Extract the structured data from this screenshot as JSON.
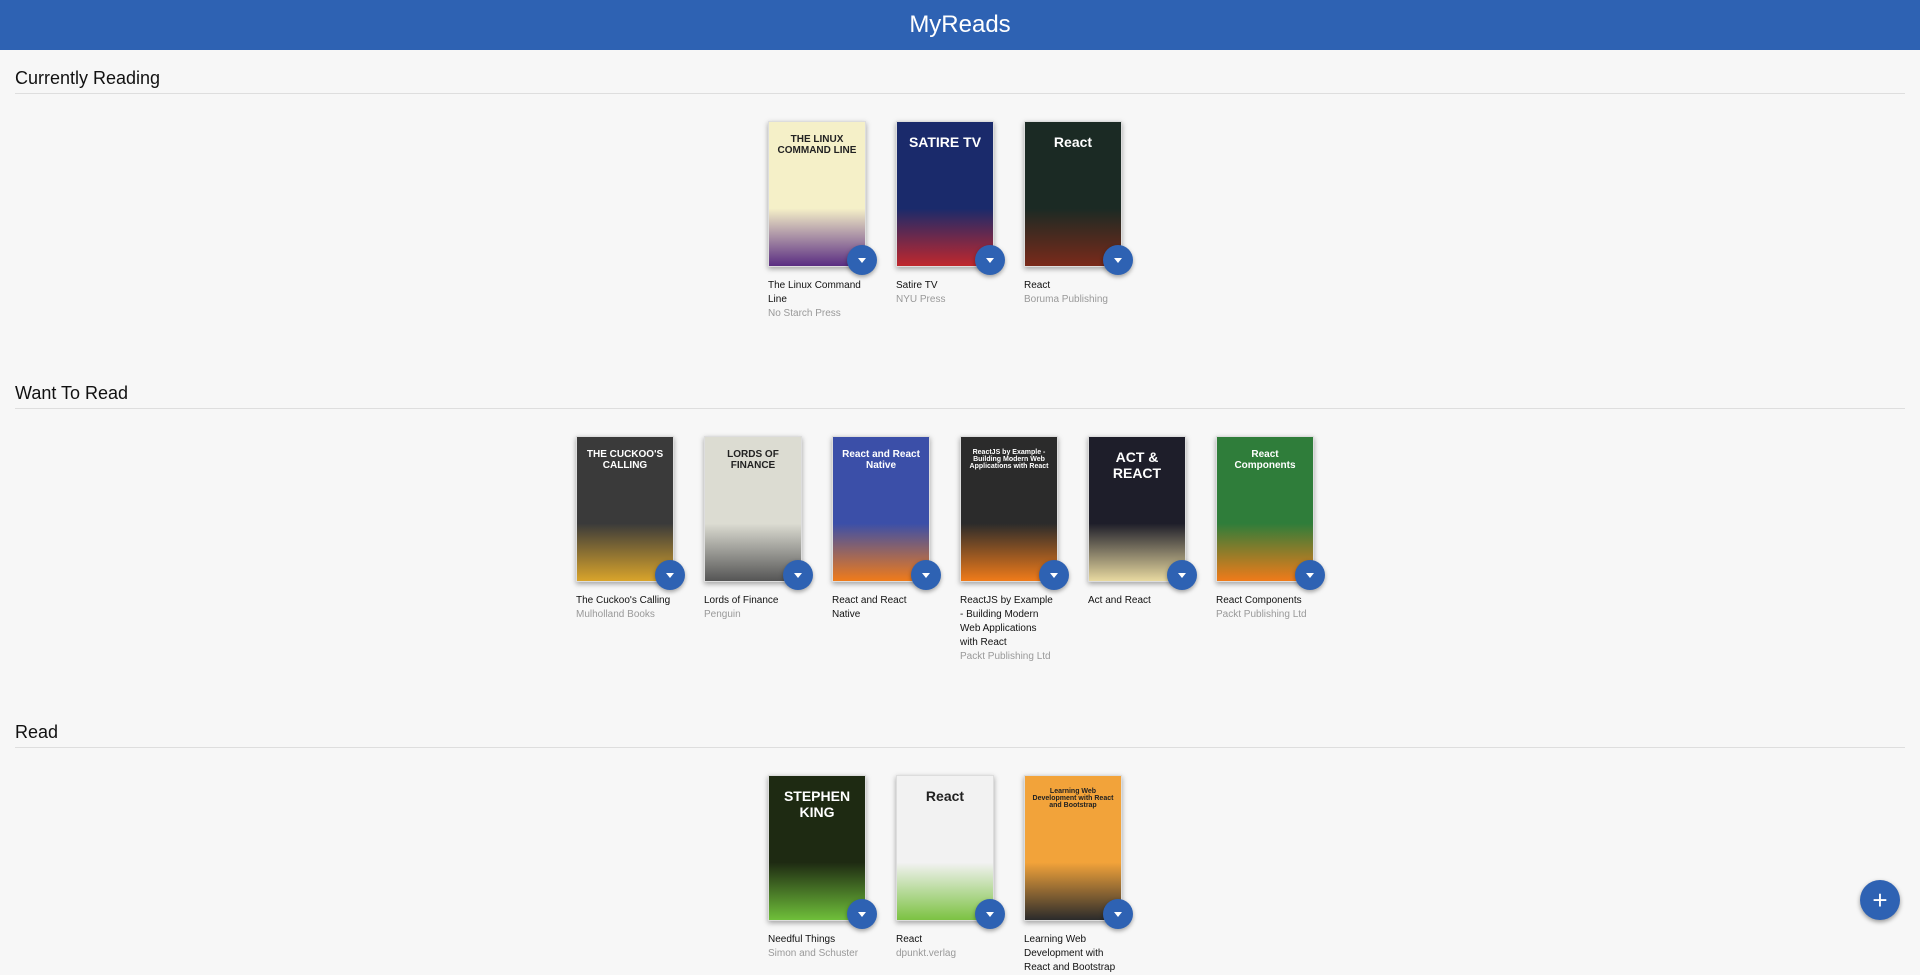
{
  "app": {
    "title": "MyReads"
  },
  "shelves": [
    {
      "title": "Currently Reading",
      "books": [
        {
          "title": "The Linux Command Line",
          "authors": "No Starch Press",
          "cover_text": "THE LINUX COMMAND LINE",
          "cover_colors": [
            "#f5f0c8",
            "#5a2d82"
          ]
        },
        {
          "title": "Satire TV",
          "authors": "NYU Press",
          "cover_text": "SATIRE TV",
          "cover_colors": [
            "#1a2a6b",
            "#c0282d"
          ]
        },
        {
          "title": "React",
          "authors": "Boruma Publishing",
          "cover_text": "React",
          "cover_colors": [
            "#1b2a24",
            "#7a2a1a"
          ]
        }
      ]
    },
    {
      "title": "Want To Read",
      "books": [
        {
          "title": "The Cuckoo's Calling",
          "authors": "Mulholland Books",
          "cover_text": "THE CUCKOO'S CALLING",
          "cover_colors": [
            "#3a3a3a",
            "#d9a42b"
          ]
        },
        {
          "title": "Lords of Finance",
          "authors": "Penguin",
          "cover_text": "LORDS OF FINANCE",
          "cover_colors": [
            "#dcdcd2",
            "#555555"
          ]
        },
        {
          "title": "React and React Native",
          "authors": "",
          "cover_text": "React and React Native",
          "cover_colors": [
            "#3b4fa8",
            "#f07b1a"
          ]
        },
        {
          "title": "ReactJS by Example - Building Modern Web Applications with React",
          "authors": "Packt Publishing Ltd",
          "cover_text": "ReactJS by Example - Building Modern Web Applications with React",
          "cover_colors": [
            "#2b2b2b",
            "#f07b1a"
          ]
        },
        {
          "title": "Act and React",
          "authors": "",
          "cover_text": "ACT & REACT",
          "cover_colors": [
            "#1e1e2a",
            "#e8d9a0"
          ]
        },
        {
          "title": "React Components",
          "authors": "Packt Publishing Ltd",
          "cover_text": "React Components",
          "cover_colors": [
            "#2f7d3a",
            "#f07b1a"
          ]
        }
      ]
    },
    {
      "title": "Read",
      "books": [
        {
          "title": "Needful Things",
          "authors": "Simon and Schuster",
          "cover_text": "STEPHEN KING",
          "cover_colors": [
            "#1e2a12",
            "#6fbf3a"
          ]
        },
        {
          "title": "React",
          "authors": "dpunkt.verlag",
          "cover_text": "React",
          "cover_colors": [
            "#f2f2f2",
            "#7cc242"
          ]
        },
        {
          "title": "Learning Web Development with React and Bootstrap",
          "authors": "",
          "cover_text": "Learning Web Development with React and Bootstrap",
          "cover_colors": [
            "#f2a33a",
            "#2b2b2b"
          ]
        }
      ]
    }
  ],
  "add_button": {
    "label": "+"
  }
}
